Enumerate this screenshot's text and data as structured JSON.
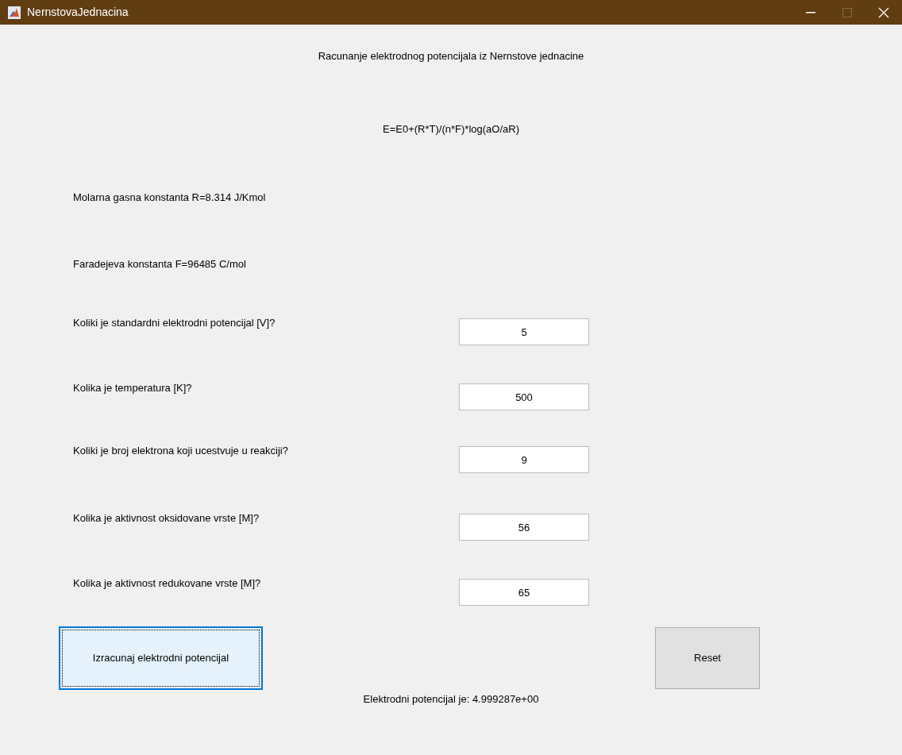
{
  "window": {
    "title": "NernstovaJednacina"
  },
  "heading": "Racunanje elektrodnog potencijala iz Nernstove jednacine",
  "formula": "E=E0+(R*T)/(n*F)*log(aO/aR)",
  "constants": [
    "Molarna gasna konstanta R=8.314 J/Kmol",
    "Faradejeva konstanta F=96485 C/mol"
  ],
  "questions": [
    {
      "label": "Koliki je standardni elektrodni potencijal [V]?",
      "value": "5"
    },
    {
      "label": "Kolika je temperatura [K]?",
      "value": "500"
    },
    {
      "label": "Koliki je broj elektrona koji ucestvuje u reakciji?",
      "value": "9"
    },
    {
      "label": "Kolika je aktivnost oksidovane vrste [M]?",
      "value": "56"
    },
    {
      "label": "Kolika je aktivnost redukovane vrste [M]?",
      "value": "65"
    }
  ],
  "buttons": [
    {
      "label": "Izracunaj elektrodni potencijal",
      "focused": true
    },
    {
      "label": "Reset",
      "focused": false
    }
  ],
  "result": "Elektrodni potencijal je: 4.999287e+00"
}
